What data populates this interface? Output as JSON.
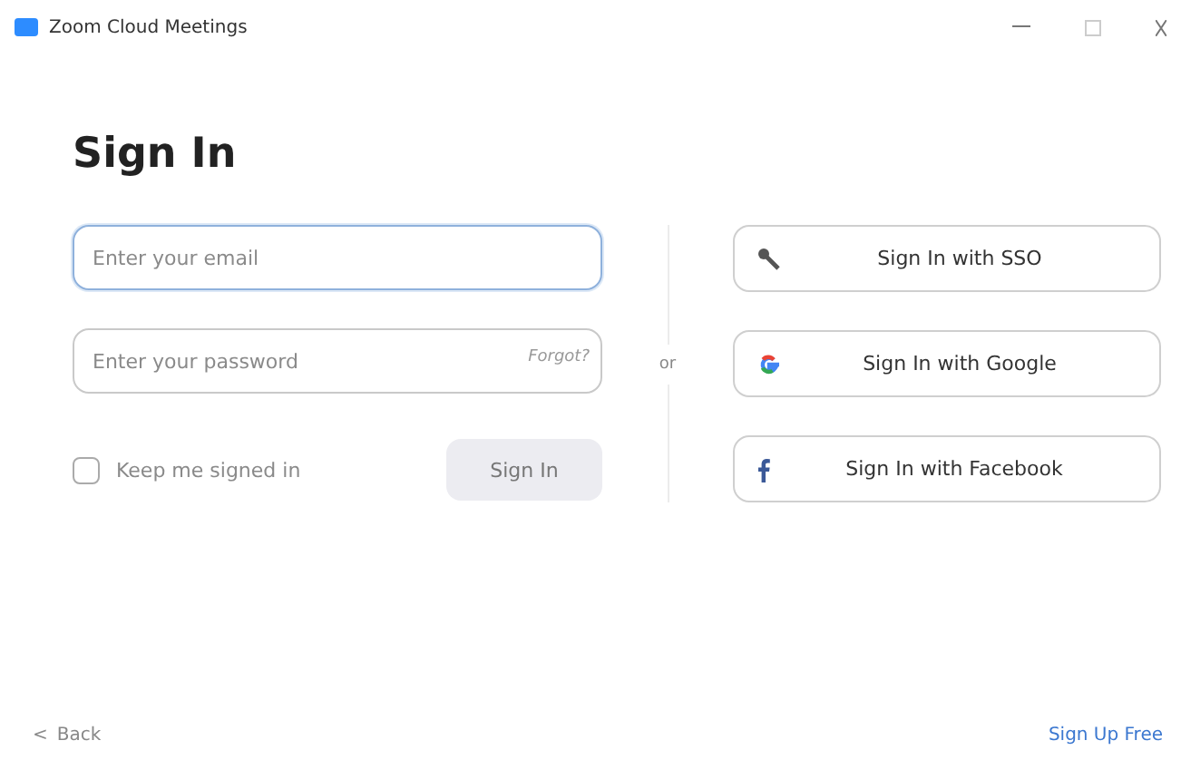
{
  "window": {
    "title": "Zoom Cloud Meetings"
  },
  "heading": "Sign In",
  "email": {
    "placeholder": "Enter your email",
    "focused": true
  },
  "password": {
    "placeholder": "Enter your password",
    "forgot": "Forgot?",
    "focused": false
  },
  "keep_signed_in": {
    "label": "Keep me signed in",
    "checked": false
  },
  "sign_in_button": {
    "label": "Sign In",
    "disabled": true
  },
  "separator": "or",
  "providers": [
    {
      "kind": "sso",
      "label": "Sign In with SSO"
    },
    {
      "kind": "google",
      "label": "Sign In with Google"
    },
    {
      "kind": "facebook",
      "label": "Sign In with Facebook"
    }
  ],
  "footer": {
    "back": "Back",
    "back_arrow": "<",
    "sign_up": "Sign Up Free"
  }
}
